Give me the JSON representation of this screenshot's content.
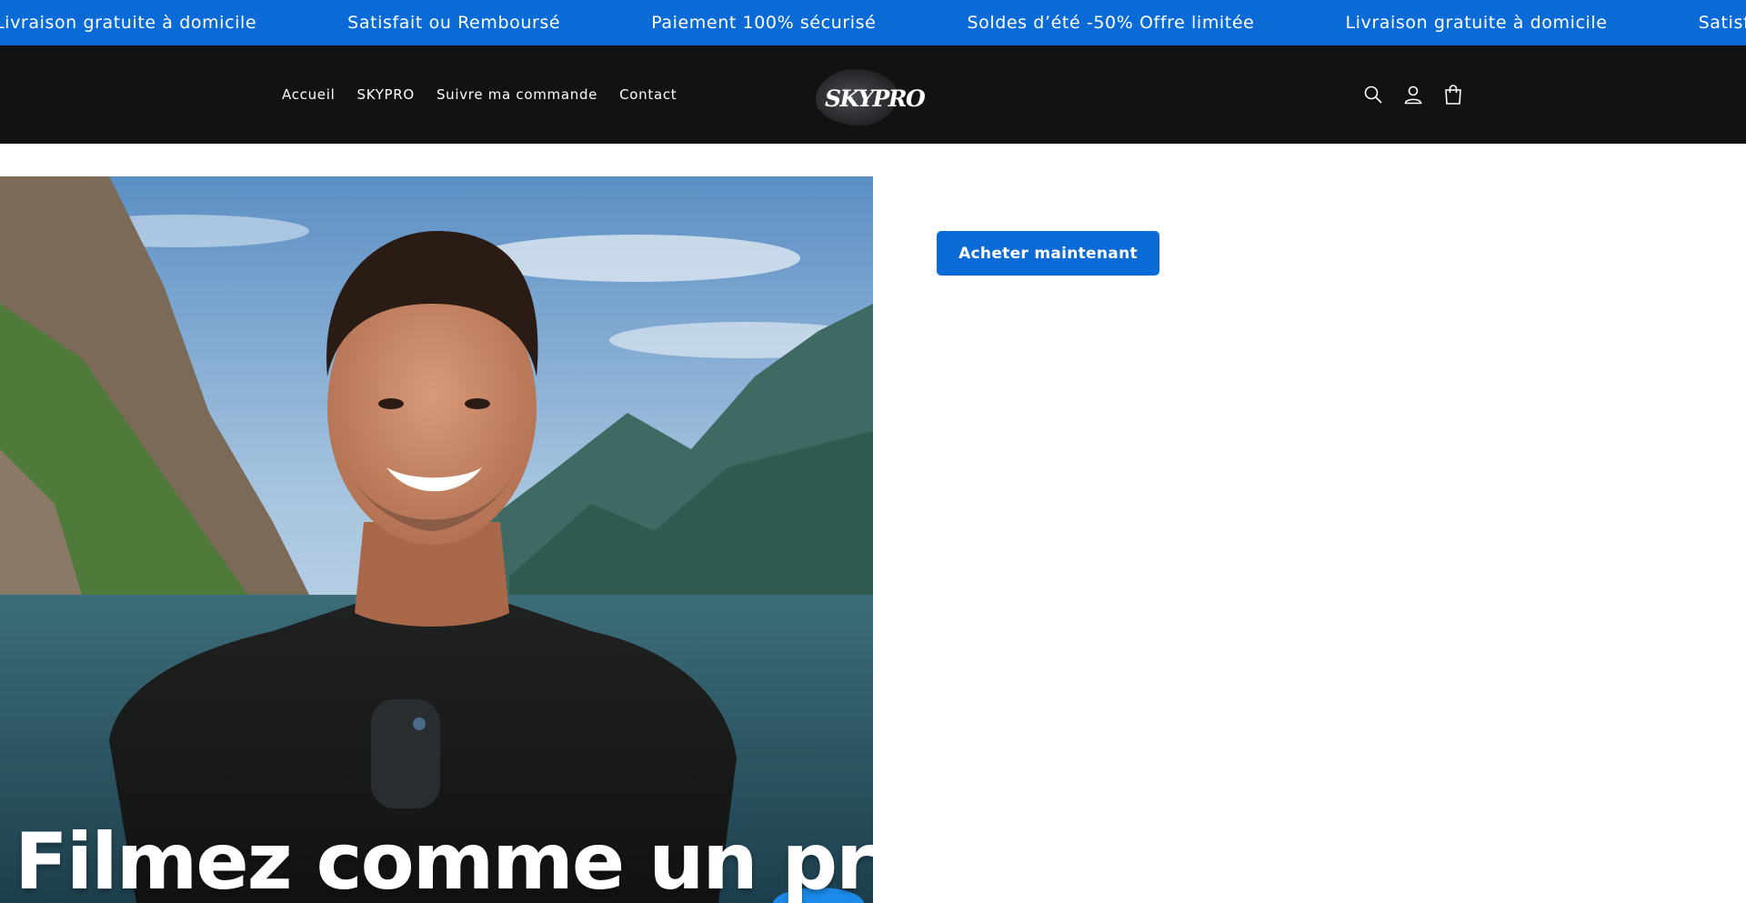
{
  "announcement": {
    "messages": [
      "Livraison gratuite à domicile",
      "Satisfait ou Remboursé",
      "Paiement 100% sécurisé",
      "Soldes d’été -50% Offre limitée",
      "Livraison gratuite à domicile",
      "Satisfait ou Remboursé"
    ],
    "background": "#0b6bd6"
  },
  "header": {
    "nav": [
      {
        "label": "Accueil"
      },
      {
        "label": "SKYPRO"
      },
      {
        "label": "Suivre ma commande"
      },
      {
        "label": "Contact"
      }
    ],
    "logo_text": "SKYPRO",
    "icons": [
      "search-icon",
      "account-icon",
      "cart-icon"
    ],
    "background": "#121212"
  },
  "hero": {
    "caption": "Filmez comme un pro"
  },
  "product": {
    "buy_label": "Acheter maintenant",
    "accent": "#0b6bd6"
  }
}
